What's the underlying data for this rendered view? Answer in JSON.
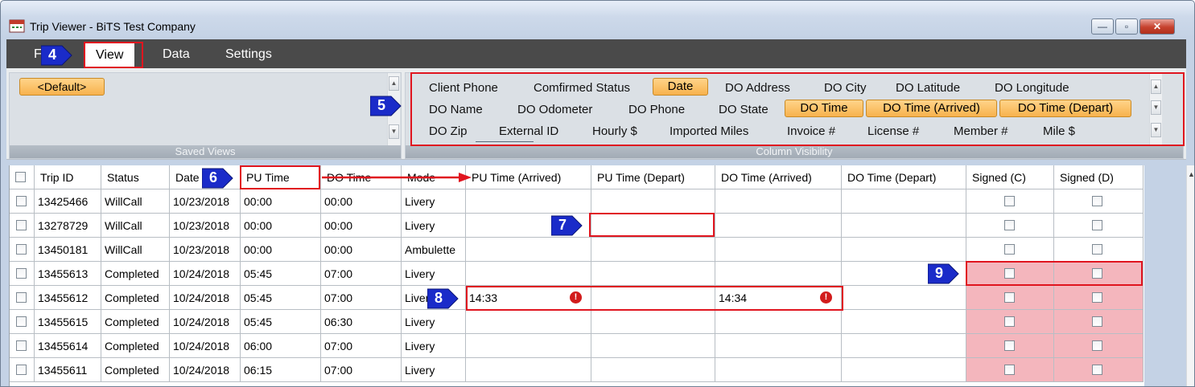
{
  "window": {
    "title": "Trip Viewer - BiTS Test Company",
    "minimize_glyph": "—",
    "maximize_glyph": "▫",
    "close_glyph": "✕"
  },
  "menu": {
    "partial_item": "F",
    "items": [
      "View",
      "Data",
      "Settings"
    ],
    "active": "View"
  },
  "saved_views": {
    "default_label": "<Default>",
    "caption": "Saved Views"
  },
  "column_visibility": {
    "caption": "Column Visibility",
    "rows": [
      [
        "Client Phone",
        "Comfirmed Status",
        "Date",
        "DO Address",
        "DO City",
        "DO Latitude",
        "DO Longitude"
      ],
      [
        "DO Name",
        "DO Odometer",
        "DO Phone",
        "DO State",
        "DO Time",
        "DO Time (Arrived)",
        "DO Time (Depart)"
      ],
      [
        "DO Zip",
        "External ID",
        "Hourly $",
        "Imported Miles",
        "Invoice #",
        "License #",
        "Member #",
        "Mile $"
      ]
    ],
    "selected": [
      "Date",
      "DO Time",
      "DO Time (Arrived)",
      "DO Time (Depart)"
    ]
  },
  "grid": {
    "columns": [
      "",
      "Trip ID",
      "Status",
      "Date",
      "PU Time",
      "DO Time",
      "Mode",
      "PU Time (Arrived)",
      "PU Time (Depart)",
      "DO Time (Arrived)",
      "DO Time (Depart)",
      "Signed (C)",
      "Signed (D)"
    ],
    "rows": [
      {
        "trip_id": "13425466",
        "status": "WillCall",
        "date": "10/23/2018",
        "pu_time": "00:00",
        "do_time": "00:00",
        "mode": "Livery",
        "pu_arrived": "",
        "pu_depart": "",
        "do_arrived": "",
        "do_depart": ""
      },
      {
        "trip_id": "13278729",
        "status": "WillCall",
        "date": "10/23/2018",
        "pu_time": "00:00",
        "do_time": "00:00",
        "mode": "Livery",
        "pu_arrived": "",
        "pu_depart": "",
        "do_arrived": "",
        "do_depart": ""
      },
      {
        "trip_id": "13450181",
        "status": "WillCall",
        "date": "10/23/2018",
        "pu_time": "00:00",
        "do_time": "00:00",
        "mode": "Ambulette",
        "pu_arrived": "",
        "pu_depart": "",
        "do_arrived": "",
        "do_depart": ""
      },
      {
        "trip_id": "13455613",
        "status": "Completed",
        "date": "10/24/2018",
        "pu_time": "05:45",
        "do_time": "07:00",
        "mode": "Livery",
        "pu_arrived": "",
        "pu_depart": "",
        "do_arrived": "",
        "do_depart": ""
      },
      {
        "trip_id": "13455612",
        "status": "Completed",
        "date": "10/24/2018",
        "pu_time": "05:45",
        "do_time": "07:00",
        "mode": "Livery",
        "pu_arrived": "14:33",
        "pu_depart": "",
        "do_arrived": "14:34",
        "do_depart": ""
      },
      {
        "trip_id": "13455615",
        "status": "Completed",
        "date": "10/24/2018",
        "pu_time": "05:45",
        "do_time": "06:30",
        "mode": "Livery",
        "pu_arrived": "",
        "pu_depart": "",
        "do_arrived": "",
        "do_depart": ""
      },
      {
        "trip_id": "13455614",
        "status": "Completed",
        "date": "10/24/2018",
        "pu_time": "06:00",
        "do_time": "07:00",
        "mode": "Livery",
        "pu_arrived": "",
        "pu_depart": "",
        "do_arrived": "",
        "do_depart": ""
      },
      {
        "trip_id": "13455611",
        "status": "Completed",
        "date": "10/24/2018",
        "pu_time": "06:15",
        "do_time": "07:00",
        "mode": "Livery",
        "pu_arrived": "",
        "pu_depart": "",
        "do_arrived": "",
        "do_depart": ""
      }
    ],
    "error_glyph": "!"
  },
  "callouts": [
    "4",
    "5",
    "6",
    "7",
    "8",
    "9"
  ],
  "colors": {
    "menubar": "#4a4a4a",
    "selected_pill": "#f7b24d",
    "highlight_red": "#e0151f",
    "signed_pink": "#f4b6bd",
    "callout_blue": "#1a2bc9"
  }
}
